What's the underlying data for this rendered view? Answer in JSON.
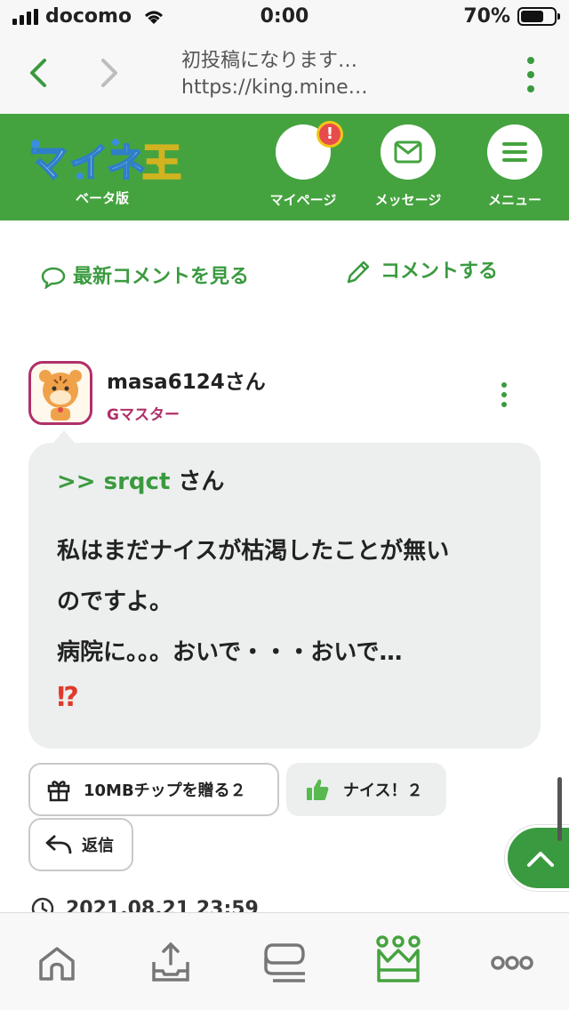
{
  "status_bar": {
    "carrier": "docomo",
    "time": "0:00",
    "battery_pct": "70%",
    "battery_level": 0.7
  },
  "browser": {
    "page_title": "初投稿になります…",
    "url": "https://king.mine…"
  },
  "site": {
    "logo_text": "マイネ王",
    "logo_badge": "ベータ版",
    "nav": {
      "mypage": "マイページ",
      "alert": "!",
      "messages": "メッセージ",
      "menu": "メニュー"
    }
  },
  "actions": {
    "latest_comments": "最新コメントを見る",
    "write_comment": "コメントする"
  },
  "comment": {
    "username": "masa6124さん",
    "rank": "Gマスター",
    "reply_prefix": ">> srqct",
    "reply_suffix": " さん",
    "body_lines": [
      "私はまだナイスが枯渇したことが無い",
      "のですよ。",
      "病院に。。。おいで・・・おいで…"
    ],
    "emoji": "⁉",
    "gift_button": "10MBチップを贈る２",
    "nice_button": "ナイス！２",
    "reply_button": "返信",
    "timestamp": "2021.08.21 23:59"
  },
  "colors": {
    "brand_green": "#45a33f",
    "accent_green": "#3a9a3f",
    "rank_magenta": "#b0306a"
  },
  "tabbar": {
    "icons": [
      "home-icon",
      "upload-tray-icon",
      "chat-icon",
      "crown-icon",
      "more-dots-icon"
    ]
  }
}
